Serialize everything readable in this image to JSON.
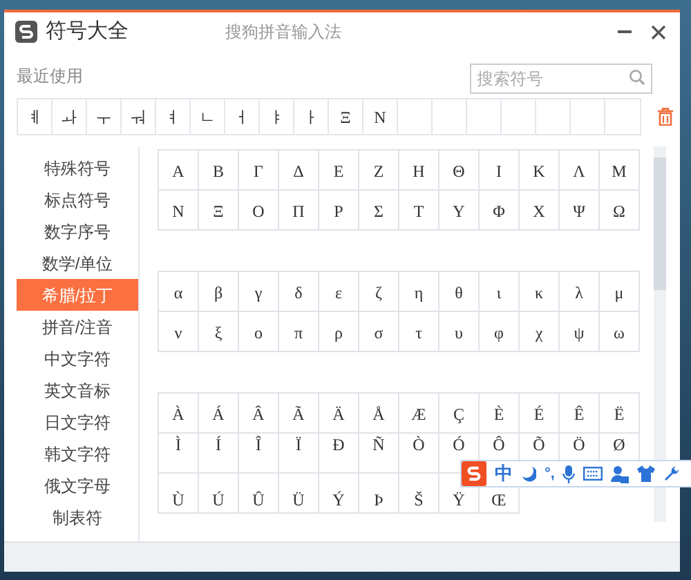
{
  "window": {
    "title": "符号大全",
    "subtitle": "搜狗拼音输入法"
  },
  "recent": {
    "label": "最近使用",
    "symbols": [
      "ㅖ",
      "ㅘ",
      "ㅜ",
      "ㅝ",
      "ㅕ",
      "ㄴ",
      "ㅓ",
      "ㅑ",
      "ㅏ",
      "Ξ",
      "N"
    ]
  },
  "search": {
    "placeholder": "搜索符号"
  },
  "categories": [
    {
      "label": "特殊符号",
      "selected": false
    },
    {
      "label": "标点符号",
      "selected": false
    },
    {
      "label": "数字序号",
      "selected": false
    },
    {
      "label": "数学/单位",
      "selected": false
    },
    {
      "label": "希腊/拉丁",
      "selected": true
    },
    {
      "label": "拼音/注音",
      "selected": false
    },
    {
      "label": "中文字符",
      "selected": false
    },
    {
      "label": "英文音标",
      "selected": false
    },
    {
      "label": "日文字符",
      "selected": false
    },
    {
      "label": "韩文字符",
      "selected": false
    },
    {
      "label": "俄文字母",
      "selected": false
    },
    {
      "label": "制表符",
      "selected": false
    }
  ],
  "symbol_groups": [
    {
      "symbols": [
        "Α",
        "Β",
        "Γ",
        "Δ",
        "Ε",
        "Ζ",
        "Η",
        "Θ",
        "Ι",
        "Κ",
        "Λ",
        "Μ",
        "Ν",
        "Ξ",
        "Ο",
        "Π",
        "Ρ",
        "Σ",
        "Τ",
        "Υ",
        "Φ",
        "Χ",
        "Ψ",
        "Ω"
      ]
    },
    {
      "symbols": [
        "α",
        "β",
        "γ",
        "δ",
        "ε",
        "ζ",
        "η",
        "θ",
        "ι",
        "κ",
        "λ",
        "μ",
        "ν",
        "ξ",
        "ο",
        "π",
        "ρ",
        "σ",
        "τ",
        "υ",
        "φ",
        "χ",
        "ψ",
        "ω"
      ]
    },
    {
      "symbols": [
        "À",
        "Á",
        "Â",
        "Ã",
        "Ä",
        "Å",
        "Æ",
        "Ç",
        "È",
        "É",
        "Ê",
        "Ë",
        "Ì",
        "Í",
        "Î",
        "Ï",
        "Ð",
        "Ñ",
        "Ò",
        "Ó",
        "Ô",
        "Õ",
        "Ö",
        "Ø",
        "Ù",
        "Ú",
        "Û",
        "Ü",
        "Ý",
        "Þ",
        "Š",
        "Ÿ",
        "Œ"
      ]
    }
  ],
  "ime_bar": {
    "mode": "中",
    "punctuation": "°,"
  }
}
